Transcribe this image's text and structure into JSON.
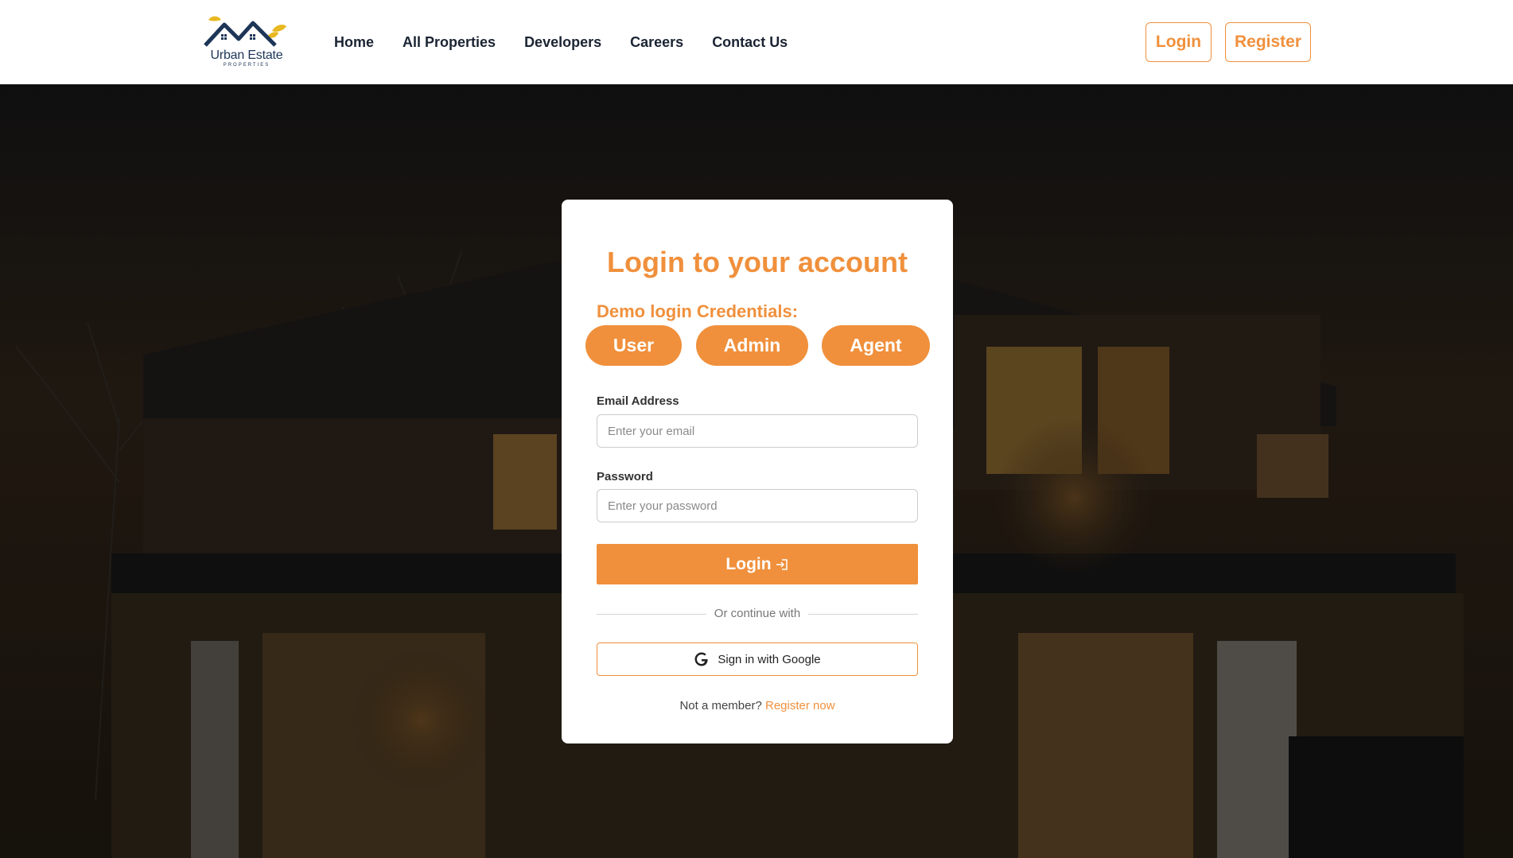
{
  "brand": {
    "name": "Urban Estate",
    "tagline": "PROPERTIES",
    "logo_icon": "house-roof-leaves-icon",
    "accent": "#f0903c"
  },
  "nav": {
    "items": [
      {
        "label": "Home"
      },
      {
        "label": "All Properties"
      },
      {
        "label": "Developers"
      },
      {
        "label": "Careers"
      },
      {
        "label": "Contact Us"
      }
    ]
  },
  "header_actions": {
    "login_label": "Login",
    "register_label": "Register"
  },
  "login_card": {
    "title": "Login to your account",
    "demo_label": "Demo login Credentials:",
    "demo_buttons": [
      "User",
      "Admin",
      "Agent"
    ],
    "email": {
      "label": "Email Address",
      "placeholder": "Enter your email",
      "value": ""
    },
    "password": {
      "label": "Password",
      "placeholder": "Enter your password",
      "value": ""
    },
    "submit_label": "Login",
    "submit_icon": "login-arrow-icon",
    "divider_text": "Or continue with",
    "google_label": "Sign in with Google",
    "google_icon": "google-g-icon",
    "footer_prefix": "Not a member?",
    "footer_link": "Register now"
  },
  "background": {
    "image": "modern-house-night-photo"
  }
}
